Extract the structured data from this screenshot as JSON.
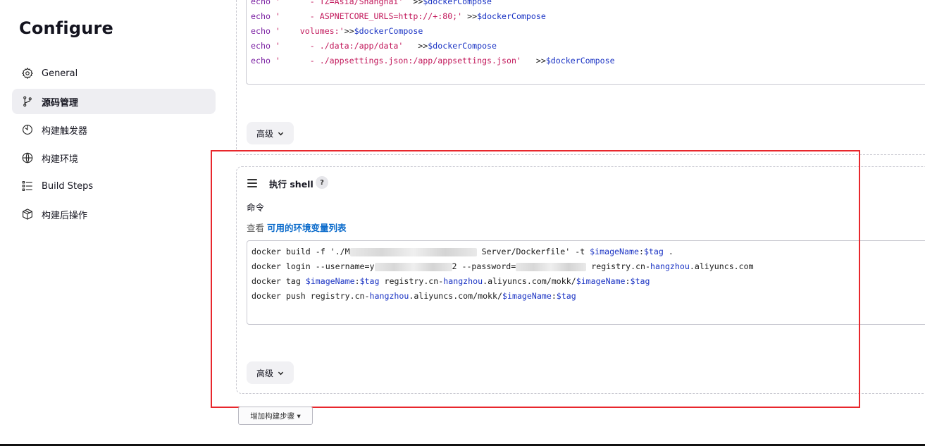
{
  "sidebar": {
    "title": "Configure",
    "items": [
      {
        "label": "General",
        "icon": "gear-icon",
        "active": false
      },
      {
        "label": "源码管理",
        "icon": "branch-icon",
        "active": true
      },
      {
        "label": "构建触发器",
        "icon": "timer-icon",
        "active": false
      },
      {
        "label": "构建环境",
        "icon": "globe-icon",
        "active": false
      },
      {
        "label": "Build Steps",
        "icon": "list-icon",
        "active": false
      },
      {
        "label": "构建后操作",
        "icon": "package-icon",
        "active": false
      }
    ]
  },
  "prev_step": {
    "code_lines": [
      {
        "a": "echo ",
        "b": "'      - TZ=Asia/Shanghai'",
        "c": "  >>",
        "d": "$dockerCompose"
      },
      {
        "a": "echo ",
        "b": "'      - ASPNETCORE_URLS=http://+:80;'",
        "c": " >>",
        "d": "$dockerCompose"
      },
      {
        "a": "echo ",
        "b": "'    volumes:'",
        "c": ">>",
        "d": "$dockerCompose"
      },
      {
        "a": "echo ",
        "b": "'      - ./data:/app/data'",
        "c": "   >>",
        "d": "$dockerCompose"
      },
      {
        "a": "echo ",
        "b": "'      - ./appsettings.json:/app/appsettings.json'",
        "c": "   >>",
        "d": "$dockerCompose"
      }
    ],
    "advanced_label": "高级"
  },
  "shell_step": {
    "title": "执行 shell",
    "help": "?",
    "command_label": "命令",
    "env_prefix": "查看 ",
    "env_link": "可用的环境变量列表",
    "code": {
      "l1a": "docker build -f './M",
      "l1b": "Server/Dockerfile' -t ",
      "l1c": "$imageName",
      "l1d": ":",
      "l1e": "$tag",
      "l1f": " .",
      "l2a": "docker login --username=y",
      "l2b": "2 --password=",
      "l2c": " registry.cn-",
      "l2d": "hangzhou",
      "l2e": ".aliyuncs.com",
      "l3a": "docker tag ",
      "l3b": "$imageName",
      "l3c": ":",
      "l3d": "$tag",
      "l3e": " registry.cn-",
      "l3f": "hangzhou",
      "l3g": ".aliyuncs.com/mokk/",
      "l3h": "$imageName",
      "l3i": ":",
      "l3j": "$tag",
      "l4a": "docker push registry.cn-",
      "l4b": "hangzhou",
      "l4c": ".aliyuncs.com/mokk/",
      "l4d": "$imageName",
      "l4e": ":",
      "l4f": "$tag"
    },
    "advanced_label": "高级"
  },
  "add_step_label": "增加构建步骤 ▾",
  "colors": {
    "highlight_box": "#e8272c",
    "link": "#0b6bcb",
    "active_nav_bg": "#eeeef2"
  }
}
